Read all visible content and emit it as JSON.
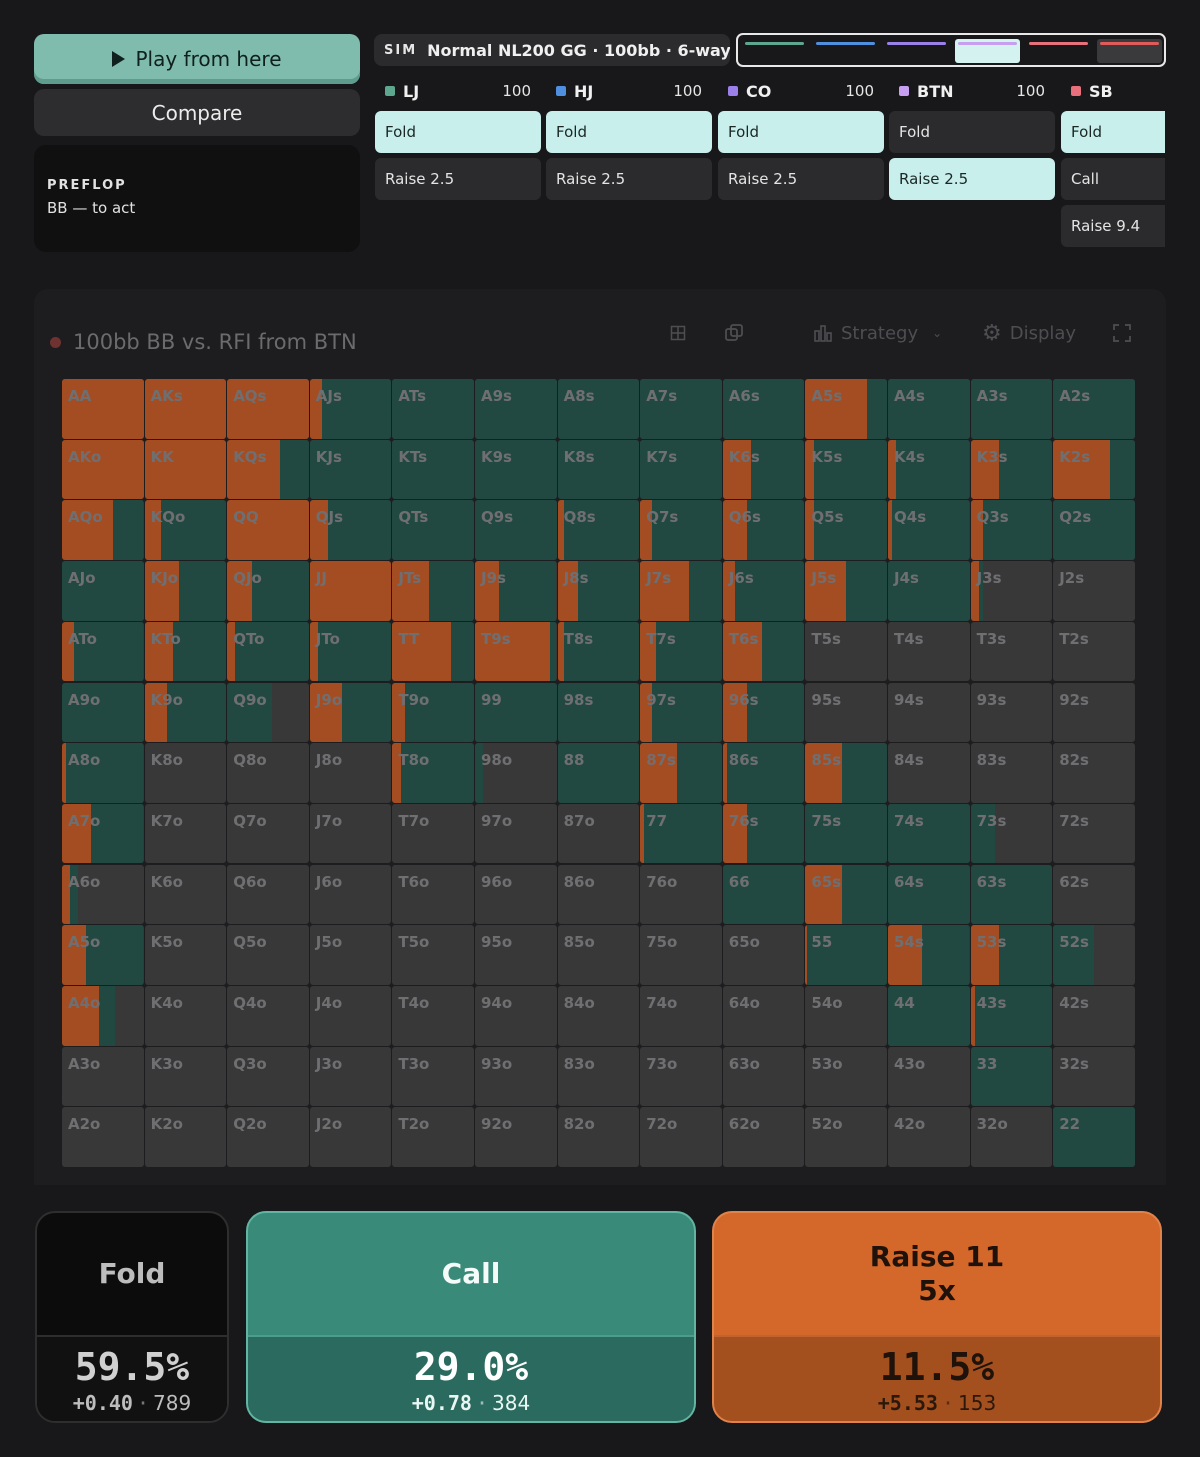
{
  "controls": {
    "play_label": "Play from here",
    "compare_label": "Compare",
    "street": "PREFLOP",
    "to_act": "BB — to act"
  },
  "sim": {
    "tag": "SIM",
    "name": "Normal NL200 GG · 100bb · 6-way",
    "swap_icon": "swap-arrows-icon"
  },
  "colors": {
    "raise": "#a54d22",
    "call": "#214941",
    "fold": "#383839",
    "accent": "#7fbcae"
  },
  "history_strip": [
    {
      "color": "#5ea78f"
    },
    {
      "color": "#4f8fe0"
    },
    {
      "color": "#9a80e8"
    },
    {
      "color": "#c69ff0",
      "active": true
    },
    {
      "color": "#e8707c"
    },
    {
      "color": "#e05a5a"
    }
  ],
  "players": [
    {
      "name": "LJ",
      "stack": "100",
      "color": "#5ea78f",
      "actions": [
        {
          "label": "Fold",
          "selected": true
        },
        {
          "label": "Raise 2.5",
          "selected": false
        }
      ]
    },
    {
      "name": "HJ",
      "stack": "100",
      "color": "#4f8fe0",
      "actions": [
        {
          "label": "Fold",
          "selected": true
        },
        {
          "label": "Raise 2.5",
          "selected": false
        }
      ]
    },
    {
      "name": "CO",
      "stack": "100",
      "color": "#9a80e8",
      "actions": [
        {
          "label": "Fold",
          "selected": true
        },
        {
          "label": "Raise 2.5",
          "selected": false
        }
      ]
    },
    {
      "name": "BTN",
      "stack": "100",
      "color": "#c69ff0",
      "actions": [
        {
          "label": "Fold",
          "selected": false
        },
        {
          "label": "Raise 2.5",
          "selected": true
        }
      ]
    },
    {
      "name": "SB",
      "stack": "",
      "color": "#e8707c",
      "actions": [
        {
          "label": "Fold",
          "selected": true
        },
        {
          "label": "Call",
          "selected": false
        },
        {
          "label": "Raise 9.4",
          "selected": false
        }
      ]
    }
  ],
  "panel": {
    "title": "100bb BB vs. RFI from BTN",
    "strategy_label": "Strategy",
    "display_label": "Display"
  },
  "grid": {
    "ranks": [
      "A",
      "K",
      "Q",
      "J",
      "T",
      "9",
      "8",
      "7",
      "6",
      "5",
      "4",
      "3",
      "2"
    ],
    "cells": [
      [
        "AA",
        1,
        0
      ],
      [
        "AKs",
        1,
        0
      ],
      [
        "AQs",
        1,
        0
      ],
      [
        "AJs",
        0.15,
        0.85
      ],
      [
        "ATs",
        0,
        1
      ],
      [
        "A9s",
        0,
        1
      ],
      [
        "A8s",
        0,
        1
      ],
      [
        "A7s",
        0,
        1
      ],
      [
        "A6s",
        0,
        1
      ],
      [
        "A5s",
        0.75,
        0.25
      ],
      [
        "A4s",
        0,
        1
      ],
      [
        "A3s",
        0,
        1
      ],
      [
        "A2s",
        0,
        1
      ],
      [
        "AKo",
        1,
        0
      ],
      [
        "KK",
        1,
        0
      ],
      [
        "KQs",
        0.65,
        0.35
      ],
      [
        "KJs",
        0,
        1
      ],
      [
        "KTs",
        0,
        1
      ],
      [
        "K9s",
        0,
        1
      ],
      [
        "K8s",
        0,
        1
      ],
      [
        "K7s",
        0,
        1
      ],
      [
        "K6s",
        0.35,
        0.65
      ],
      [
        "K5s",
        0.1,
        0.9
      ],
      [
        "K4s",
        0.1,
        0.9
      ],
      [
        "K3s",
        0.35,
        0.65
      ],
      [
        "K2s",
        0.7,
        0.3
      ],
      [
        "AQo",
        0.62,
        0.38
      ],
      [
        "KQo",
        0.2,
        0.8
      ],
      [
        "QQ",
        1,
        0
      ],
      [
        "QJs",
        0.22,
        0.78
      ],
      [
        "QTs",
        0,
        1
      ],
      [
        "Q9s",
        0,
        1
      ],
      [
        "Q8s",
        0.08,
        0.92
      ],
      [
        "Q7s",
        0.15,
        0.85
      ],
      [
        "Q6s",
        0.3,
        0.7
      ],
      [
        "Q5s",
        0.1,
        0.9
      ],
      [
        "Q4s",
        0.05,
        0.95
      ],
      [
        "Q3s",
        0.15,
        0.85
      ],
      [
        "Q2s",
        0,
        1
      ],
      [
        "AJo",
        0,
        1
      ],
      [
        "KJo",
        0.42,
        0.58
      ],
      [
        "QJo",
        0.3,
        0.7
      ],
      [
        "JJ",
        1,
        0
      ],
      [
        "JTs",
        0.45,
        0.55
      ],
      [
        "J9s",
        0.3,
        0.7
      ],
      [
        "J8s",
        0.25,
        0.75
      ],
      [
        "J7s",
        0.6,
        0.4
      ],
      [
        "J6s",
        0.15,
        0.85
      ],
      [
        "J5s",
        0.5,
        0.5
      ],
      [
        "J4s",
        0,
        1
      ],
      [
        "J3s",
        0.1,
        0.05
      ],
      [
        "J2s",
        0,
        0
      ],
      [
        "ATo",
        0.15,
        0.85
      ],
      [
        "KTo",
        0.35,
        0.65
      ],
      [
        "QTo",
        0.1,
        0.9
      ],
      [
        "JTo",
        0.1,
        0.9
      ],
      [
        "TT",
        0.72,
        0.28
      ],
      [
        "T9s",
        0.92,
        0.08
      ],
      [
        "T8s",
        0.08,
        0.92
      ],
      [
        "T7s",
        0.2,
        0.8
      ],
      [
        "T6s",
        0.48,
        0.52
      ],
      [
        "T5s",
        0,
        0
      ],
      [
        "T4s",
        0,
        0
      ],
      [
        "T3s",
        0,
        0
      ],
      [
        "T2s",
        0,
        0
      ],
      [
        "A9o",
        0,
        1
      ],
      [
        "K9o",
        0.28,
        0.72
      ],
      [
        "Q9o",
        0,
        0.55
      ],
      [
        "J9o",
        0.4,
        0.6
      ],
      [
        "T9o",
        0.15,
        0.85
      ],
      [
        "99",
        0,
        1
      ],
      [
        "98s",
        0,
        1
      ],
      [
        "97s",
        0.15,
        0.85
      ],
      [
        "96s",
        0.3,
        0.7
      ],
      [
        "95s",
        0,
        0
      ],
      [
        "94s",
        0,
        0
      ],
      [
        "93s",
        0,
        0
      ],
      [
        "92s",
        0,
        0
      ],
      [
        "A8o",
        0.05,
        0.95
      ],
      [
        "K8o",
        0,
        0
      ],
      [
        "Q8o",
        0,
        0
      ],
      [
        "J8o",
        0,
        0
      ],
      [
        "T8o",
        0.1,
        0.9
      ],
      [
        "98o",
        0,
        0.1
      ],
      [
        "88",
        0,
        1
      ],
      [
        "87s",
        0.45,
        0.55
      ],
      [
        "86s",
        0.05,
        0.95
      ],
      [
        "85s",
        0.45,
        0.55
      ],
      [
        "84s",
        0,
        0
      ],
      [
        "83s",
        0,
        0
      ],
      [
        "82s",
        0,
        0
      ],
      [
        "A7o",
        0.35,
        0.65
      ],
      [
        "K7o",
        0,
        0
      ],
      [
        "Q7o",
        0,
        0
      ],
      [
        "J7o",
        0,
        0
      ],
      [
        "T7o",
        0,
        0
      ],
      [
        "97o",
        0,
        0
      ],
      [
        "87o",
        0,
        0
      ],
      [
        "77",
        0.05,
        0.95
      ],
      [
        "76s",
        0.3,
        0.7
      ],
      [
        "75s",
        0,
        1
      ],
      [
        "74s",
        0,
        1
      ],
      [
        "73s",
        0,
        0.3
      ],
      [
        "72s",
        0,
        0
      ],
      [
        "A6o",
        0.1,
        0.1
      ],
      [
        "K6o",
        0,
        0
      ],
      [
        "Q6o",
        0,
        0
      ],
      [
        "J6o",
        0,
        0
      ],
      [
        "T6o",
        0,
        0
      ],
      [
        "96o",
        0,
        0
      ],
      [
        "86o",
        0,
        0
      ],
      [
        "76o",
        0,
        0
      ],
      [
        "66",
        0,
        1
      ],
      [
        "65s",
        0.45,
        0.55
      ],
      [
        "64s",
        0,
        1
      ],
      [
        "63s",
        0,
        1
      ],
      [
        "62s",
        0,
        0
      ],
      [
        "A5o",
        0.3,
        0.7
      ],
      [
        "K5o",
        0,
        0
      ],
      [
        "Q5o",
        0,
        0
      ],
      [
        "J5o",
        0,
        0
      ],
      [
        "T5o",
        0,
        0
      ],
      [
        "95o",
        0,
        0
      ],
      [
        "85o",
        0,
        0
      ],
      [
        "75o",
        0,
        0
      ],
      [
        "65o",
        0,
        0
      ],
      [
        "55",
        0.02,
        0.98
      ],
      [
        "54s",
        0.42,
        0.58
      ],
      [
        "53s",
        0.35,
        0.65
      ],
      [
        "52s",
        0,
        0.5
      ],
      [
        "A4o",
        0.45,
        0.2
      ],
      [
        "K4o",
        0,
        0
      ],
      [
        "Q4o",
        0,
        0
      ],
      [
        "J4o",
        0,
        0
      ],
      [
        "T4o",
        0,
        0
      ],
      [
        "94o",
        0,
        0
      ],
      [
        "84o",
        0,
        0
      ],
      [
        "74o",
        0,
        0
      ],
      [
        "64o",
        0,
        0
      ],
      [
        "54o",
        0,
        0
      ],
      [
        "44",
        0,
        1
      ],
      [
        "43s",
        0.05,
        0.95
      ],
      [
        "42s",
        0,
        0
      ],
      [
        "A3o",
        0,
        0
      ],
      [
        "K3o",
        0,
        0
      ],
      [
        "Q3o",
        0,
        0
      ],
      [
        "J3o",
        0,
        0
      ],
      [
        "T3o",
        0,
        0
      ],
      [
        "93o",
        0,
        0
      ],
      [
        "83o",
        0,
        0
      ],
      [
        "73o",
        0,
        0
      ],
      [
        "63o",
        0,
        0
      ],
      [
        "53o",
        0,
        0
      ],
      [
        "43o",
        0,
        0
      ],
      [
        "33",
        0,
        1
      ],
      [
        "32s",
        0,
        0
      ],
      [
        "A2o",
        0,
        0
      ],
      [
        "K2o",
        0,
        0
      ],
      [
        "Q2o",
        0,
        0
      ],
      [
        "J2o",
        0,
        0
      ],
      [
        "T2o",
        0,
        0
      ],
      [
        "92o",
        0,
        0
      ],
      [
        "82o",
        0,
        0
      ],
      [
        "72o",
        0,
        0
      ],
      [
        "62o",
        0,
        0
      ],
      [
        "52o",
        0,
        0
      ],
      [
        "42o",
        0,
        0
      ],
      [
        "32o",
        0,
        0
      ],
      [
        "22",
        0,
        1
      ]
    ]
  },
  "actions": [
    {
      "id": "fold",
      "label": "Fold",
      "label2": "",
      "pct": "59.5%",
      "ev": "+0.40",
      "combos": "789"
    },
    {
      "id": "call",
      "label": "Call",
      "label2": "",
      "pct": "29.0%",
      "ev": "+0.78",
      "combos": "384"
    },
    {
      "id": "raise",
      "label": "Raise 11",
      "label2": "5x",
      "pct": "11.5%",
      "ev": "+5.53",
      "combos": "153"
    }
  ]
}
